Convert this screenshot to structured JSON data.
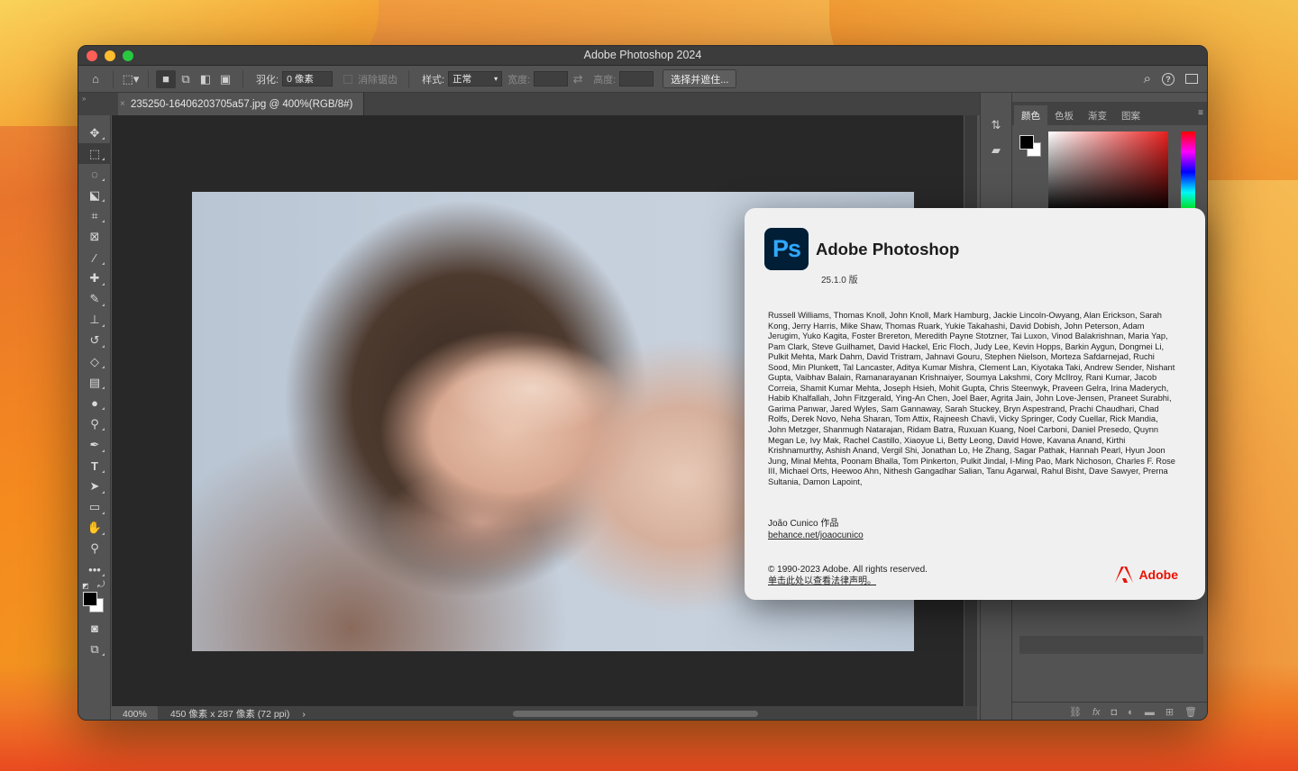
{
  "window": {
    "title": "Adobe Photoshop 2024"
  },
  "options_bar": {
    "feather_label": "羽化:",
    "feather_value": "0 像素",
    "antialias_label": "消除锯齿",
    "style_label": "样式:",
    "style_value": "正常",
    "width_label": "宽度:",
    "height_label": "高度:",
    "select_mask_button": "选择并遮住..."
  },
  "document": {
    "tab_title": "235250-16406203705a57.jpg @ 400%(RGB/8#)",
    "zoom": "400%",
    "dimensions": "450 像素 x 287 像素 (72 ppi)"
  },
  "panel": {
    "tabs": [
      "颜色",
      "色板",
      "渐变",
      "图案"
    ],
    "active_tab": 0
  },
  "about": {
    "app_name": "Adobe Photoshop",
    "logo_text": "Ps",
    "version": "25.1.0 版",
    "credits": "Russell Williams, Thomas Knoll, John Knoll, Mark Hamburg, Jackie Lincoln-Owyang, Alan Erickson, Sarah Kong, Jerry Harris, Mike Shaw, Thomas Ruark, Yukie Takahashi, David Dobish, John Peterson, Adam Jerugim, Yuko Kagita, Foster Brereton, Meredith Payne Stotzner, Tai Luxon, Vinod Balakrishnan, Maria Yap, Pam Clark, Steve Guilhamet, David Hackel, Eric Floch, Judy Lee, Kevin Hopps, Barkin Aygun, Dongmei Li, Pulkit Mehta, Mark Dahm, David Tristram, Jahnavi Gouru, Stephen Nielson, Morteza Safdarnejad, Ruchi Sood, Min Plunkett, Tal Lancaster, Aditya Kumar Mishra, Clement Lan, Kiyotaka Taki, Andrew Sender, Nishant Gupta, Vaibhav Balain, Ramanarayanan Krishnaiyer, Soumya Lakshmi, Cory McIlroy, Rani Kumar, Jacob Correia, Shamit Kumar Mehta, Joseph Hsieh, Mohit Gupta, Chris Steenwyk, Praveen Gelra, Irina Maderych, Habib Khalfallah, John Fitzgerald, Ying-An Chen, Joel Baer, Agrita Jain, John Love-Jensen, Praneet Surabhi, Garima Panwar, Jared Wyles, Sam Gannaway, Sarah Stuckey, Bryn Aspestrand, Prachi Chaudhari, Chad Rolfs, Derek Novo, Neha Sharan, Tom Attix, Rajneesh Chavli, Vicky Springer, Cody Cuellar, Rick Mandia, John Metzger, Shanmugh Natarajan, Ridam Batra, Ruxuan Kuang, Noel Carboni, Daniel Presedo, Quynn Megan Le, Ivy Mak, Rachel Castillo, Xiaoyue Li, Betty Leong, David Howe, Kavana Anand, Kirthi Krishnamurthy, Ashish Anand, Vergil Shi, Jonathan Lo, He Zhang, Sagar Pathak, Hannah Pearl, Hyun Joon Jung, Minal Mehta, Poonam Bhalla, Tom Pinkerton, Pulkit Jindal, I-Ming Pao, Mark Nichoson, Charles F. Rose III, Michael Orts, Heewoo Ahn, Nithesh Gangadhar Salian, Tanu Agarwal, Rahul Bisht, Dave Sawyer, Prerna Sultania, Damon Lapoint,",
    "artwork_credit": "João Cunico 作品",
    "artwork_link": "behance.net/joaocunico",
    "copyright": "© 1990-2023 Adobe. All rights reserved.",
    "legal_link": "单击此处以查看法律声明。",
    "brand": "Adobe"
  },
  "colors": {
    "ps_logo_bg": "#001e36",
    "ps_logo_text": "#31a8ff",
    "adobe_red": "#eb1000"
  }
}
